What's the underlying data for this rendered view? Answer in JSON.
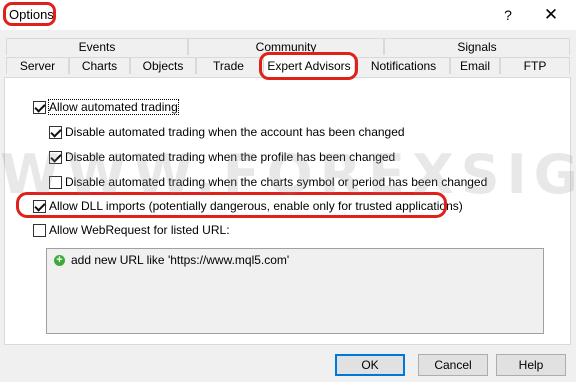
{
  "window": {
    "title": "Options",
    "help": "?",
    "close": "✕"
  },
  "tabs": {
    "top_row": [
      "Events",
      "Community",
      "Signals"
    ],
    "bottom_row": [
      "Server",
      "Charts",
      "Objects",
      "Trade",
      "Expert Advisors",
      "Notifications",
      "Email",
      "FTP"
    ],
    "selected": "Expert Advisors"
  },
  "options": {
    "allow_automated_trading": {
      "label": "Allow automated trading",
      "checked": true
    },
    "disable_on_account_change": {
      "label": "Disable automated trading when the account has been changed",
      "checked": true
    },
    "disable_on_profile_change": {
      "label": "Disable automated trading when the profile has been changed",
      "checked": true
    },
    "disable_on_symbol_change": {
      "label": "Disable automated trading when the charts symbol or period has been changed",
      "checked": false
    },
    "allow_dll_imports": {
      "label": "Allow DLL imports (potentially dangerous, enable only for trusted applications)",
      "checked": true
    },
    "allow_webrequest": {
      "label": "Allow WebRequest for listed URL:",
      "checked": false
    }
  },
  "url_list": {
    "add_item": "add new URL like 'https://www.mql5.com'"
  },
  "watermark": "WWW.FOREXSIGNALS.COM",
  "buttons": {
    "ok": "OK",
    "cancel": "Cancel",
    "help": "Help"
  },
  "colors": {
    "highlight": "#e0201a",
    "accent": "#0078d7",
    "add_icon": "#3cab3a"
  }
}
